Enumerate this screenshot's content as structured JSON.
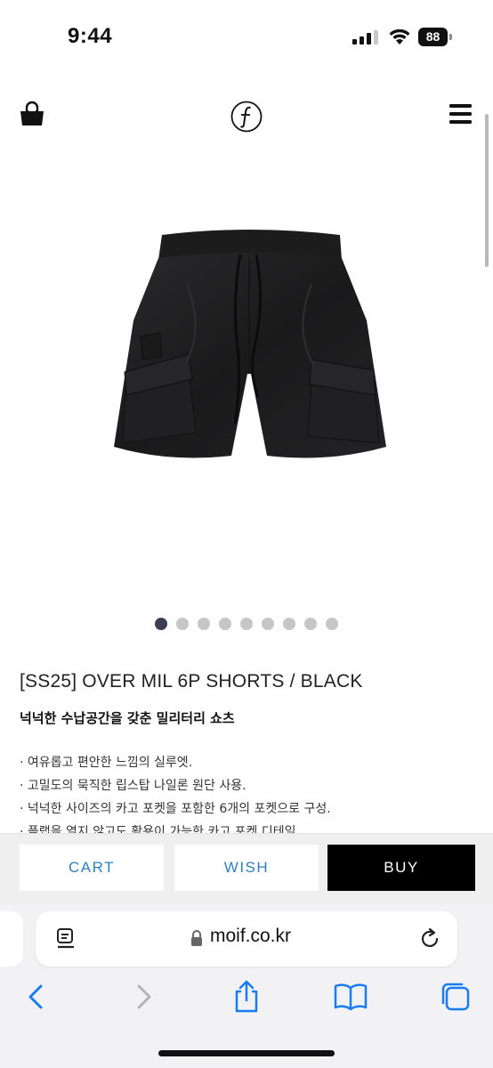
{
  "status_bar": {
    "time": "9:44",
    "battery": "88"
  },
  "header": {
    "icons": [
      "shopping-bag-icon",
      "brand-logo",
      "menu-icon"
    ]
  },
  "carousel": {
    "total": 9,
    "active": 1
  },
  "product": {
    "title": "[SS25] OVER MIL 6P SHORTS / BLACK",
    "subtitle": "넉넉한 수납공간을 갖춘 밀리터리 쇼츠",
    "description": [
      "· 여유롭고 편안한 느낌의 실루엣.",
      "· 고밀도의 묵직한 립스탑 나일론 원단 사용.",
      "· 넉넉한 사이즈의 카고 포켓을 포함한 6개의 포켓으로 구성.",
      "· 플랩을 열지 않고도 활용이 가능한 카고 포켓 디테일"
    ]
  },
  "actions": {
    "cart_label": "CART",
    "wish_label": "WISH",
    "buy_label": "BUY"
  },
  "browser": {
    "url": "moif.co.kr",
    "toolbar": [
      "back-icon",
      "forward-icon",
      "share-icon",
      "bookmarks-icon",
      "tabs-icon"
    ]
  },
  "colors": {
    "accent_link": "#2f7fbf",
    "buy_bg": "#000000",
    "dot_active": "#3a3f52",
    "dot_inactive": "#c6c6c6",
    "ios_blue": "#1a7cf2"
  }
}
